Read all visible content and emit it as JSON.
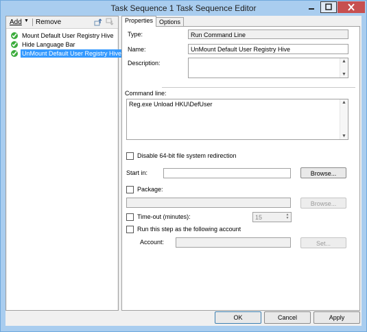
{
  "window": {
    "title": "Task Sequence 1 Task Sequence Editor"
  },
  "toolbar": {
    "add_label": "Add",
    "remove_label": "Remove"
  },
  "tree": {
    "items": [
      {
        "label": "Mount Default User Registry Hive",
        "selected": false
      },
      {
        "label": "Hide Language Bar",
        "selected": false
      },
      {
        "label": "UnMount Default User Registry Hive",
        "selected": true
      }
    ]
  },
  "tabs": [
    {
      "label": "Properties",
      "active": true
    },
    {
      "label": "Options",
      "active": false
    }
  ],
  "props": {
    "type_label": "Type:",
    "type_value": "Run Command Line",
    "name_label": "Name:",
    "name_value": "UnMount Default User Registry Hive",
    "description_label": "Description:",
    "description_value": "",
    "command_line_label": "Command line:",
    "command_line_value": "Reg.exe Unload HKU\\DefUser",
    "disable_64bit_label": "Disable 64-bit file system redirection",
    "start_in_label": "Start in:",
    "start_in_value": "",
    "browse_label": "Browse...",
    "package_label": "Package:",
    "package_value": "",
    "browse2_label": "Browse...",
    "timeout_label": "Time-out (minutes):",
    "timeout_value": "15",
    "run_as_label": "Run this step as the following account",
    "account_label": "Account:",
    "account_value": "",
    "set_label": "Set..."
  },
  "footer": {
    "ok_label": "OK",
    "cancel_label": "Cancel",
    "apply_label": "Apply"
  },
  "colors": {
    "titlebar": "#a9cdef",
    "close_button": "#c75050",
    "selection": "#3399ff",
    "check_icon": "#3cac3c"
  }
}
